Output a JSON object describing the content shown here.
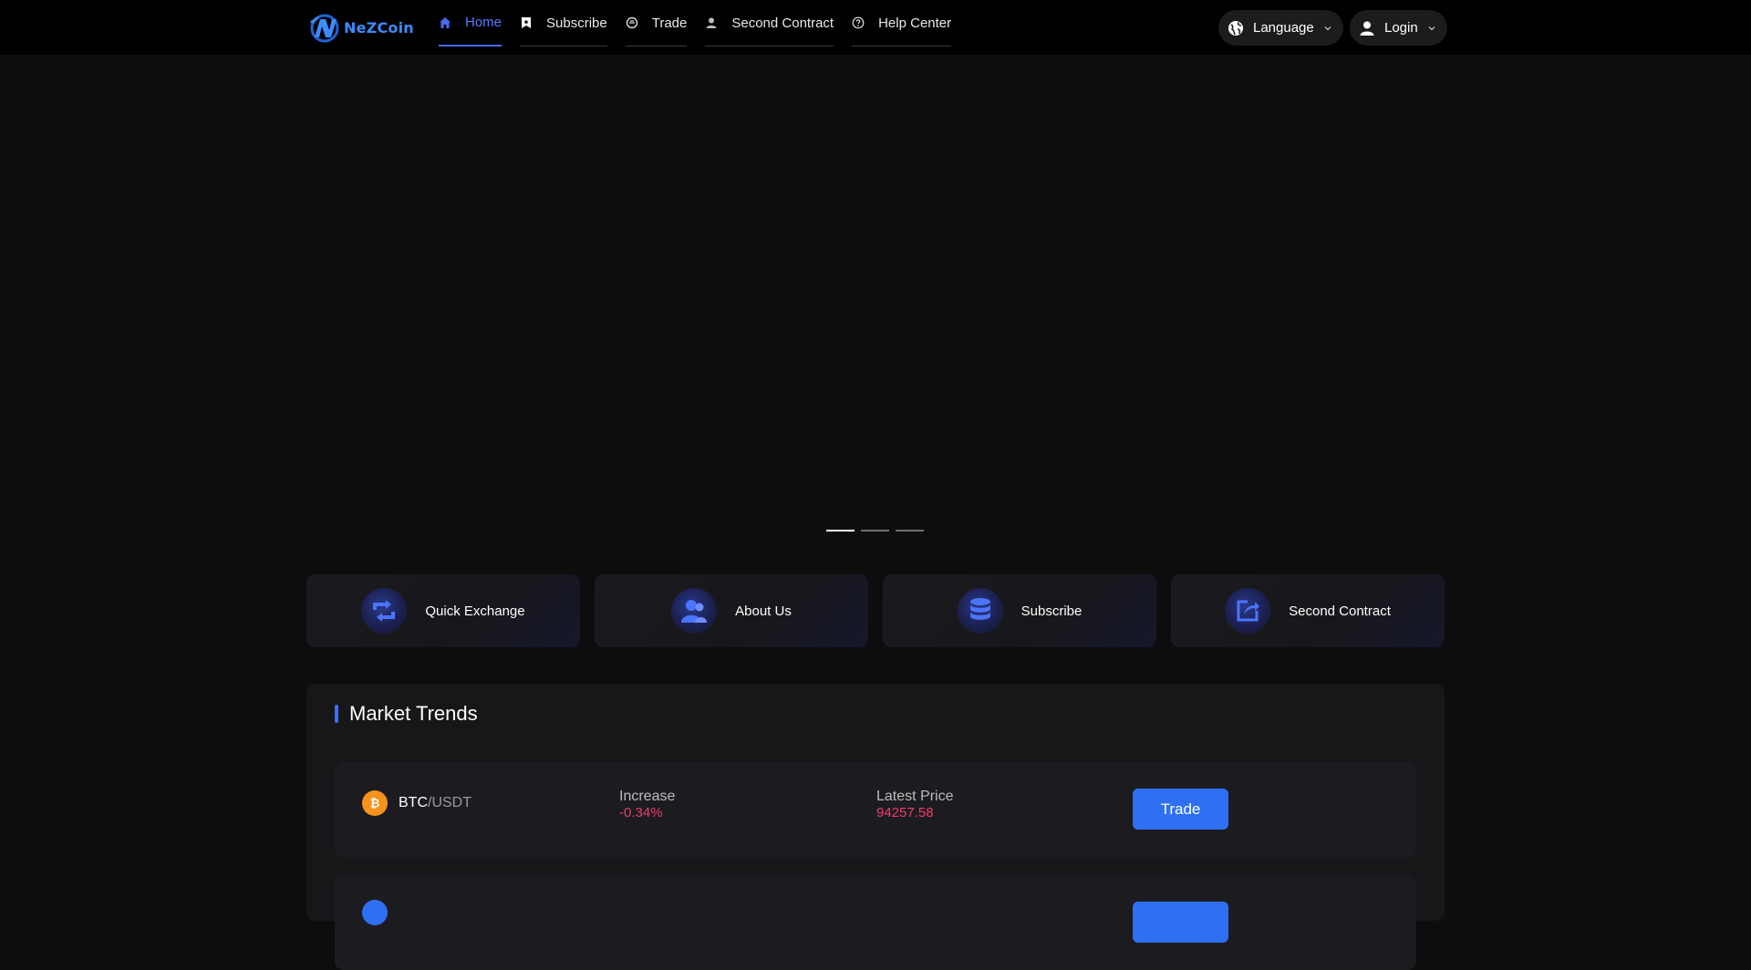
{
  "header": {
    "brand": "NeZCoin",
    "nav": [
      {
        "label": "Home",
        "icon": "home-icon",
        "active": true
      },
      {
        "label": "Subscribe",
        "icon": "bookmark-star-icon"
      },
      {
        "label": "Trade",
        "icon": "coin-icon"
      },
      {
        "label": "Second Contract",
        "icon": "user-icon"
      },
      {
        "label": "Help Center",
        "icon": "help-circle-icon"
      }
    ],
    "language_label": "Language",
    "login_label": "Login"
  },
  "banner": {
    "slides": 3,
    "active_slide": 1
  },
  "quick_links": [
    {
      "label": "Quick Exchange",
      "icon": "exchange-icon"
    },
    {
      "label": "About Us",
      "icon": "users-icon"
    },
    {
      "label": "Subscribe",
      "icon": "database-icon"
    },
    {
      "label": "Second Contract",
      "icon": "share-icon"
    }
  ],
  "market": {
    "title": "Market Trends",
    "rows": [
      {
        "base": "BTC",
        "quote": "/USDT",
        "increase_label": "Increase",
        "increase": "-0.34%",
        "price_label": "Latest Price",
        "price": "94257.58",
        "trade_label": "Trade"
      }
    ]
  },
  "colors": {
    "accent": "#2f6ff3",
    "negative": "#ef3b6b",
    "bitcoin": "#f7931a"
  }
}
